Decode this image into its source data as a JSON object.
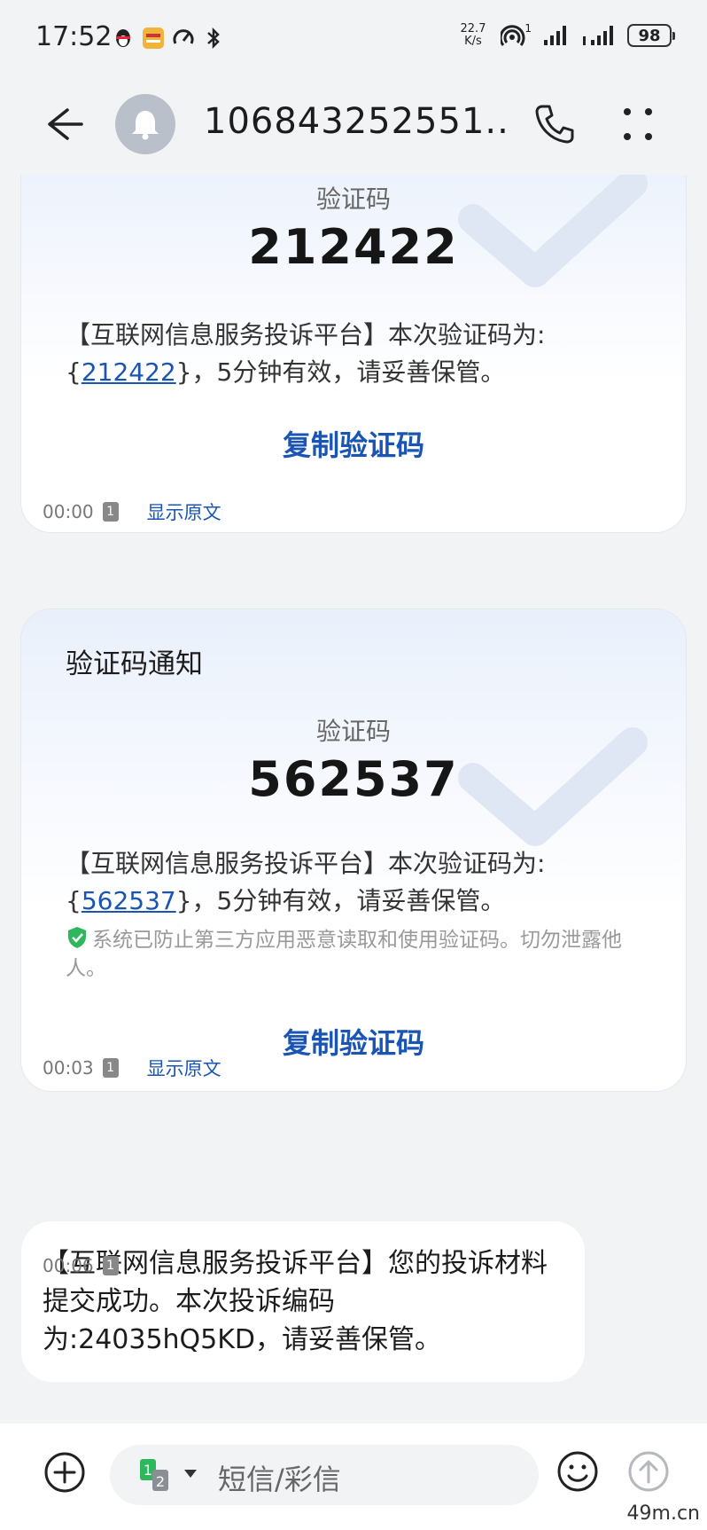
{
  "status_bar": {
    "time": "17:52",
    "net_speed_value": "22.7",
    "net_speed_unit": "K/s",
    "hotspot_count": "1",
    "battery": "98"
  },
  "header": {
    "contact": "106843252551..."
  },
  "messages": [
    {
      "code_label": "验证码",
      "code": "212422",
      "body_prefix": "【互联网信息服务投诉平台】本次验证码为:{",
      "body_code": "212422",
      "body_suffix": "}，5分钟有效，请妥善保管。",
      "copy_label": "复制验证码",
      "time": "00:00",
      "sim": "1",
      "show_original": "显示原文"
    },
    {
      "title": "验证码通知",
      "code_label": "验证码",
      "code": "562537",
      "body_prefix": "【互联网信息服务投诉平台】本次验证码为:{",
      "body_code": "562537",
      "body_suffix": "}，5分钟有效，请妥善保管。",
      "notice": "系统已防止第三方应用恶意读取和使用验证码。切勿泄露他人。",
      "copy_label": "复制验证码",
      "time": "00:03",
      "sim": "1",
      "show_original": "显示原文"
    },
    {
      "text": "【互联网信息服务投诉平台】您的投诉材料提交成功。本次投诉编码为:24035hQ5KD，请妥善保管。",
      "time": "00:06",
      "sim": "1"
    }
  ],
  "input": {
    "sim_primary": "1",
    "sim_secondary": "2",
    "placeholder": "短信/彩信"
  },
  "watermark": "49m.cn",
  "colors": {
    "accent": "#1a55b3",
    "background": "#f1f3f5",
    "shield": "#2fb85b"
  }
}
